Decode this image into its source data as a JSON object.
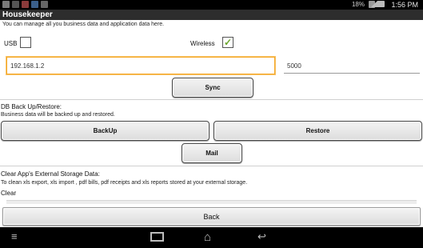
{
  "status_bar": {
    "battery_percent": "18%",
    "time": "1:56 PM"
  },
  "app": {
    "title": "Housekeeper",
    "intro": "You can manage all you business data and application data here."
  },
  "connection": {
    "usb_label": "USB",
    "usb_checked": false,
    "wireless_label": "Wireless",
    "wireless_checked": true,
    "ip_value": "192.168.1.2",
    "port_value": "5000",
    "sync_label": "Sync"
  },
  "backup": {
    "title": "DB Back Up/Restore:",
    "desc": "Business data will be backed up and restored.",
    "backup_label": "BackUp",
    "restore_label": "Restore",
    "mail_label": "Mail"
  },
  "clear": {
    "title": "Clear App's External Storage Data:",
    "desc": "To clean xls export, xls import , pdf bills, pdf receipts and  xls reports stored at your external storage.",
    "clear_label": "Clear"
  },
  "footer": {
    "back_label": "Back"
  },
  "icons": {
    "check": "✓",
    "menu": "menu-icon",
    "recent": "recent-apps-icon",
    "home": "home-icon",
    "nav_back": "back-icon"
  },
  "colors": {
    "accent_focus": "#f5a623",
    "wireless_check": "#6aa52a"
  }
}
